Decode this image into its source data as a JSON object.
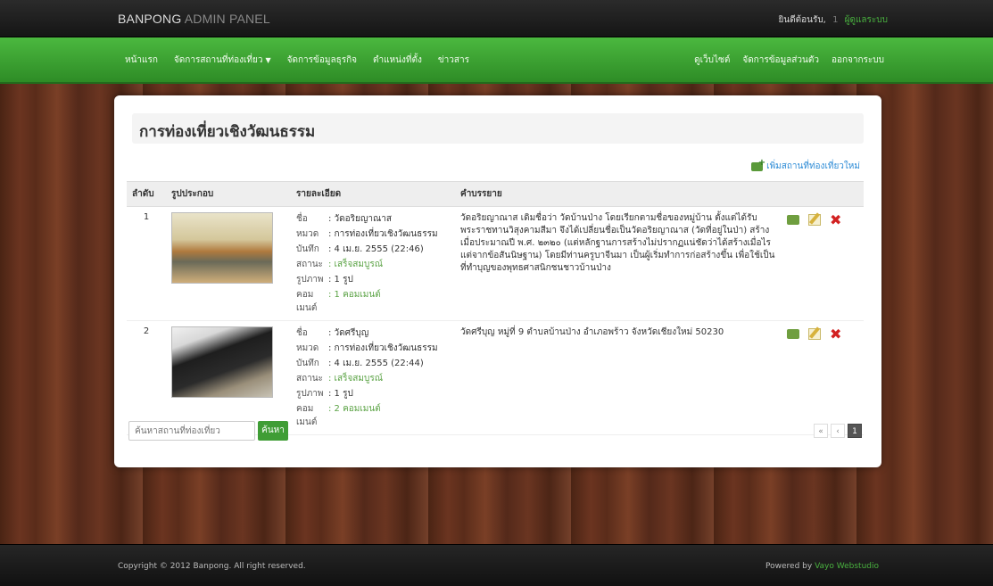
{
  "header": {
    "brand_main": "BANPONG",
    "brand_rest": "ADMIN PANEL",
    "welcome": "ยินดีต้อนรับ,",
    "user_prefix": "1",
    "user_name": "ผู้ดูแลระบบ"
  },
  "nav": {
    "left": [
      {
        "label": "หน้าแรก"
      },
      {
        "label": "จัดการสถานที่ท่องเที่ยว",
        "has_caret": true
      },
      {
        "label": "จัดการข้อมูลธุรกิจ"
      },
      {
        "label": "ตำแหน่งที่ตั้ง"
      },
      {
        "label": "ข่าวสาร"
      }
    ],
    "right": [
      {
        "label": "ดูเว็บไซต์"
      },
      {
        "label": "จัดการข้อมูลส่วนตัว"
      },
      {
        "label": "ออกจากระบบ"
      }
    ]
  },
  "page": {
    "title": "การท่องเที่ยวเชิงวัฒนธรรม",
    "add_link": "เพิ่มสถานที่ท่องเที่ยวใหม่"
  },
  "table": {
    "headers": [
      "ลำดับ",
      "รูปประกอบ",
      "รายละเอียด",
      "คำบรรยาย"
    ],
    "detail_labels": {
      "name": "ชื่อ",
      "category": "หมวด",
      "date": "บันทึก",
      "status": "สถานะ",
      "images": "รูปภาพ",
      "comments": "คอมเมนต์"
    },
    "rows": [
      {
        "no": "1",
        "name": ": วัดอริยญาณาส",
        "category": ": การท่องเที่ยวเชิงวัฒนธรรม",
        "date": ": 4 เม.ย. 2555 (22:46)",
        "status": ": เสร็จสมบูรณ์",
        "images": ": 1 รูป",
        "comments": ": 1 คอมเมนต์",
        "description": "วัดอริยญาณาส เดิมชื่อว่า วัดบ้านป่าง โดยเรียกตามชื่อของหมู่บ้าน ตั้งแต่ได้รับพระราชทานวิสุงคามสีมา จึงได้เปลี่ยนชื่อเป็นวัดอริยญาณาส (วัดที่อยู่ในป่า) สร้างเมื่อประมาณปี พ.ศ. ๒๓๒๐ (แต่หลักฐานการสร้างไม่ปรากฏแน่ชัดว่าได้สร้างเมื่อไร แต่จากข้อสันนิษฐาน) โดยมีท่านครูบาจีนมา เป็นผู้เริ่มทำการก่อสร้างขึ้น เพื่อใช้เป็นที่ทำบุญของพุทธศาสนิกชนชาวบ้านป่าง"
      },
      {
        "no": "2",
        "name": ": วัดศรีบุญ",
        "category": ": การท่องเที่ยวเชิงวัฒนธรรม",
        "date": ": 4 เม.ย. 2555 (22:44)",
        "status": ": เสร็จสมบูรณ์",
        "images": ": 1 รูป",
        "comments": ": 2 คอมเมนต์",
        "description": "วัดศรีบุญ หมู่ที่ 9 ตำบลบ้านป่าง อำเภอพร้าว จังหวัดเชียงใหม่ 50230"
      }
    ]
  },
  "search": {
    "placeholder": "ค้นหาสถานที่ท่องเที่ยว",
    "button": "ค้นหา"
  },
  "pager": {
    "prev2": "«",
    "prev1": "‹",
    "current": "1"
  },
  "footer": {
    "copyright": "Copyright © 2012 Banpong. All right reserved.",
    "powered_prefix": "Powered by",
    "powered_link": "Vayo Webstudio"
  },
  "colors": {
    "nav_green": "#3aa12f",
    "link_blue": "#2c8bd6",
    "delete_red": "#d22121"
  }
}
